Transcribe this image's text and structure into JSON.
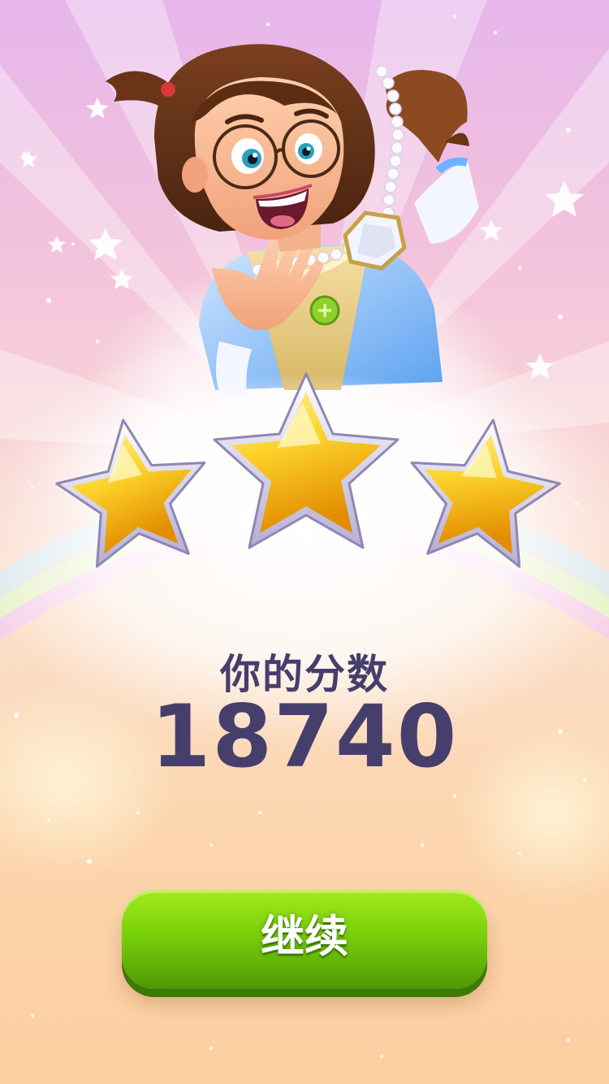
{
  "result": {
    "stars_earned": 3,
    "stars_total": 3,
    "score_label": "你的分数",
    "score_value": "18740"
  },
  "actions": {
    "continue_label": "继续"
  },
  "colors": {
    "score_text": "#463f6c",
    "button_green": "#78d00a",
    "star_gold": "#f7b500"
  }
}
